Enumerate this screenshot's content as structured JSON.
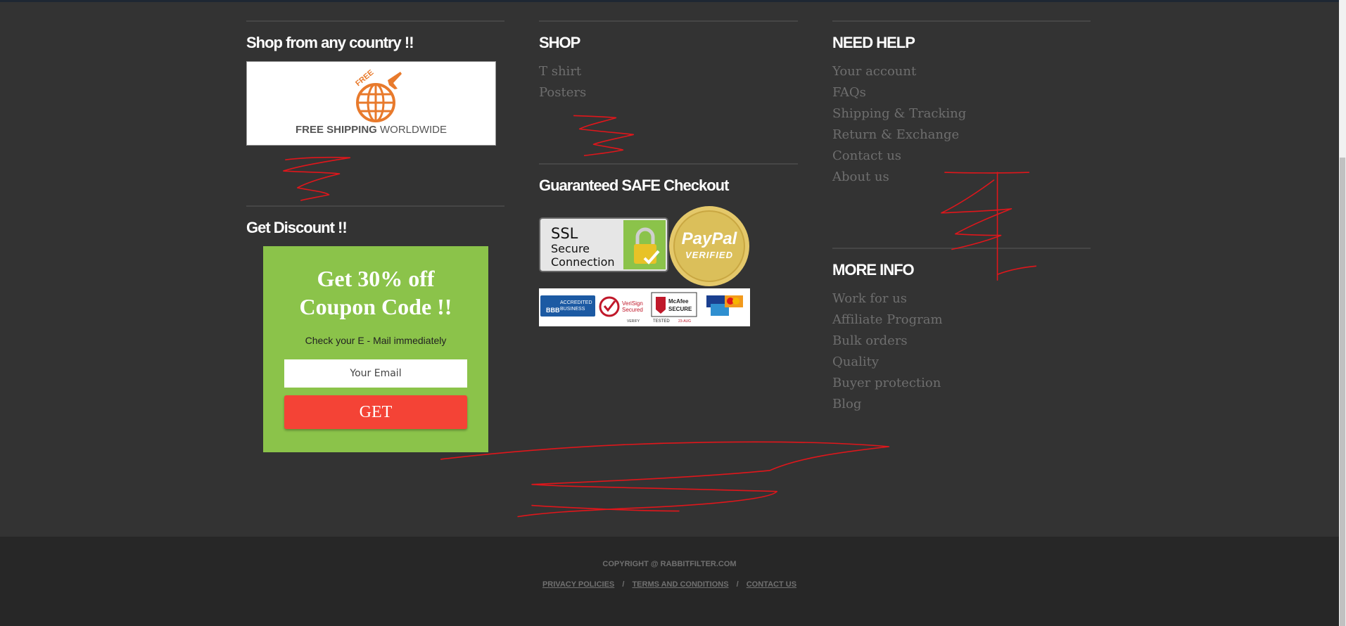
{
  "shipping": {
    "heading": "Shop from any country !!",
    "banner_badge": "FREE",
    "banner_text_bold": "FREE SHIPPING",
    "banner_text_rest": " WORLDWIDE"
  },
  "discount": {
    "heading": "Get Discount !!",
    "title_line1": "Get 30% off",
    "title_line2": "Coupon Code !!",
    "subtitle": "Check your E - Mail immediately",
    "email_placeholder": "Your Email",
    "button_label": "GET"
  },
  "shop": {
    "heading": "SHOP",
    "links": [
      "T shirt",
      "Posters"
    ]
  },
  "checkout": {
    "heading": "Guaranteed SAFE Checkout",
    "ssl_line1": "SSL",
    "ssl_line2": "Secure",
    "ssl_line3": "Connection",
    "paypal_line1": "PayPal",
    "paypal_line2": "VERIFIED",
    "bbb_line1": "ACCREDITED",
    "bbb_line2": "BUSINESS",
    "bbb_logo": "BBB",
    "verisign_line1": "VeriSign",
    "verisign_line2": "Secured",
    "verisign_line3": "VERIFY",
    "mcafee_line1": "McAfee",
    "mcafee_line2": "SECURE",
    "mcafee_line3": "TESTED",
    "mcafee_date": "23-AUG"
  },
  "need_help": {
    "heading": "NEED HELP",
    "links": [
      "Your account",
      "FAQs",
      "Shipping & Tracking",
      "Return & Exchange",
      "Contact us",
      "About us"
    ]
  },
  "more_info": {
    "heading": "MORE INFO",
    "links": [
      "Work for us",
      "Affiliate Program",
      "Bulk orders",
      "Quality",
      "Buyer protection",
      "Blog"
    ]
  },
  "bottom": {
    "copyright": "COPYRIGHT @ RABBITFILTER.COM",
    "links": [
      "PRIVACY POLICIES",
      "TERMS AND CONDITIONS",
      "CONTACT US"
    ],
    "separator": "/"
  },
  "colors": {
    "background": "#333333",
    "bottom_bar": "#272727",
    "discount_green": "#8bc34a",
    "get_button_red": "#f44336",
    "shipping_orange": "#e87a2c",
    "link_gray": "#6e6e6e",
    "scribble_red": "#e0161b"
  }
}
